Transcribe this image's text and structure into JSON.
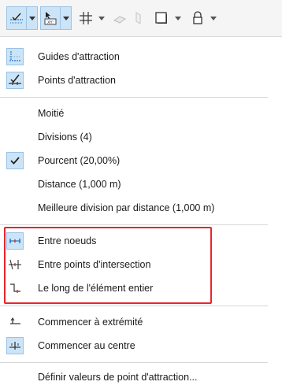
{
  "toolbar": {
    "buttons": [
      {
        "name": "guides-snap-icon",
        "selected": true
      },
      {
        "name": "xy-coordinates-icon",
        "selected": true
      },
      {
        "name": "grid-snap-icon",
        "selected": false
      },
      {
        "name": "plane-icon",
        "selected": false
      },
      {
        "name": "trace-icon",
        "selected": false
      },
      {
        "name": "frame-icon",
        "selected": false
      },
      {
        "name": "lock-icon",
        "selected": false
      }
    ]
  },
  "menu": {
    "items": [
      {
        "label": "Guides d'attraction",
        "icon": "guides-icon"
      },
      {
        "label": "Points d'attraction",
        "icon": "snap-points-icon"
      },
      {
        "label": "Moitié",
        "icon": ""
      },
      {
        "label": "Divisions (4)",
        "icon": ""
      },
      {
        "label": "Pourcent (20,00%)",
        "icon": "checkmark-icon"
      },
      {
        "label": "Distance (1,000 m)",
        "icon": ""
      },
      {
        "label": "Meilleure division par distance (1,000 m)",
        "icon": ""
      },
      {
        "label": "Entre noeuds",
        "icon": "between-nodes-icon"
      },
      {
        "label": "Entre points d'intersection",
        "icon": "between-intersections-icon"
      },
      {
        "label": "Le long de l'élément entier",
        "icon": "along-element-icon"
      },
      {
        "label": "Commencer à extrémité",
        "icon": "start-endpoint-icon"
      },
      {
        "label": "Commencer au centre",
        "icon": "start-center-icon"
      },
      {
        "label": "Définir valeurs de point d'attraction...",
        "icon": ""
      }
    ]
  },
  "colors": {
    "selected_bg": "#cce4f7",
    "highlight_border": "#e8262b",
    "icon_blue": "#1e73c8"
  }
}
